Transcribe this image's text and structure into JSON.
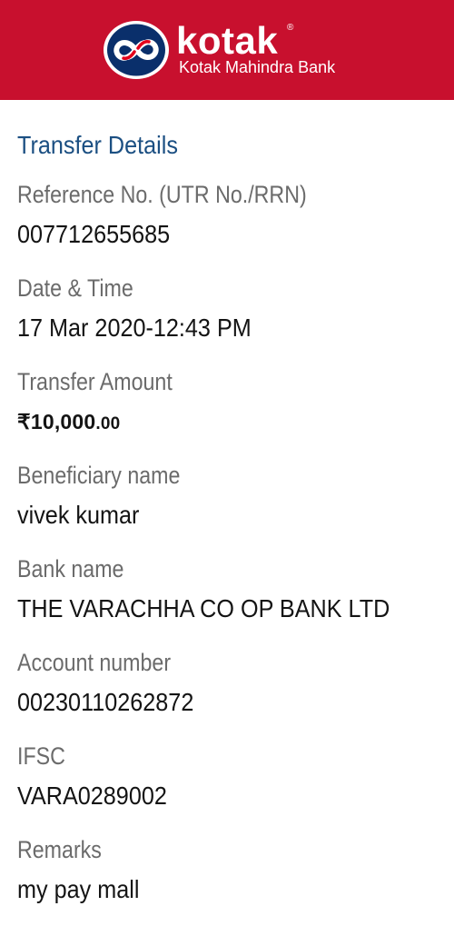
{
  "header": {
    "brand_name": "kotak",
    "registered_mark": "®",
    "brand_subtitle": "Kotak Mahindra Bank",
    "background_color": "#c8102e",
    "logo_icon": "kotak-infinity-logo-icon"
  },
  "transfer": {
    "section_title": "Transfer Details",
    "reference": {
      "label": "Reference No. (UTR No./RRN)",
      "value": "007712655685"
    },
    "datetime": {
      "label": "Date & Time",
      "value": "17 Mar 2020-12:43 PM"
    },
    "amount": {
      "label": "Transfer Amount",
      "value_main": "₹10,000",
      "value_decimals": ".00"
    },
    "beneficiary": {
      "label": "Beneficiary name",
      "value": "vivek kumar"
    },
    "bank": {
      "label": "Bank name",
      "value": "THE VARACHHA CO OP BANK LTD"
    },
    "account": {
      "label": "Account number",
      "value": "00230110262872"
    },
    "ifsc": {
      "label": "IFSC",
      "value": "VARA0289002"
    },
    "remarks": {
      "label": "Remarks",
      "value": "my pay mall"
    }
  },
  "colors": {
    "title": "#1b4f82",
    "label": "#6b6b6b",
    "value": "#141414"
  }
}
